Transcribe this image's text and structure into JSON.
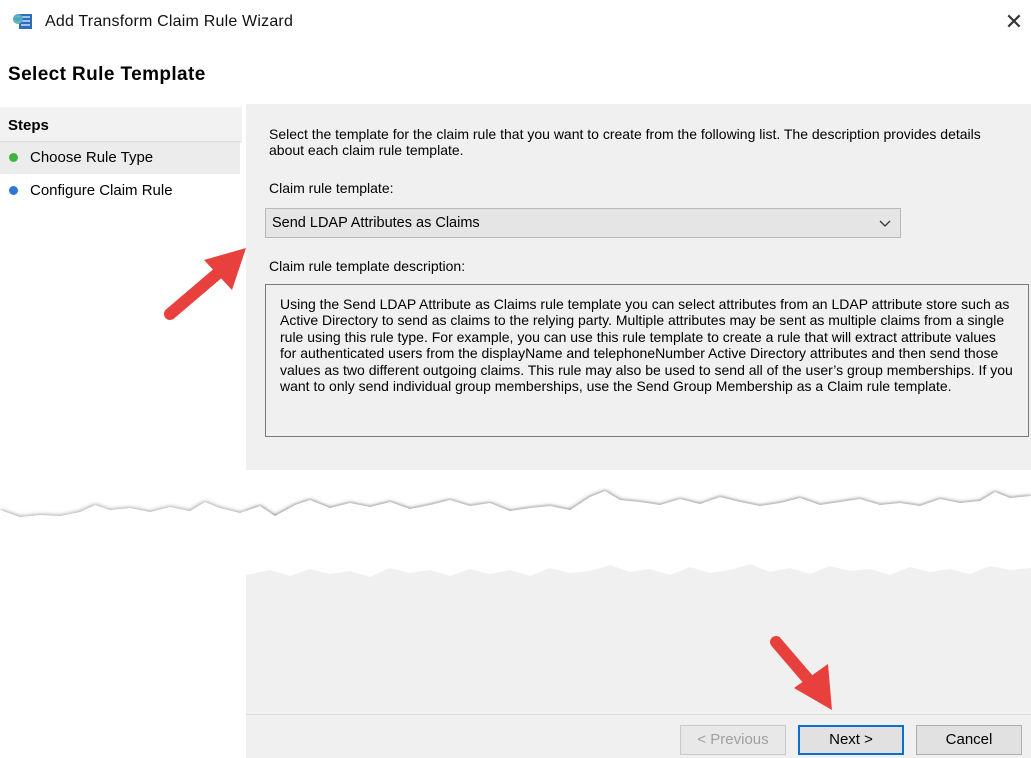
{
  "window": {
    "title": "Add Transform Claim Rule Wizard",
    "close_glyph": "✕"
  },
  "page": {
    "title": "Select Rule Template"
  },
  "steps": {
    "header": "Steps",
    "items": [
      {
        "label": "Choose Rule Type",
        "status": "current",
        "dot_color": "#3fb43f"
      },
      {
        "label": "Configure Claim Rule",
        "status": "pending",
        "dot_color": "#2a78d8"
      }
    ]
  },
  "content": {
    "intro": "Select the template for the claim rule that you want to create from the following list. The description provides details about each claim rule template.",
    "template_label": "Claim rule template:",
    "template_value": "Send LDAP Attributes as Claims",
    "description_label": "Claim rule template description:",
    "description": "Using the Send LDAP Attribute as Claims rule template you can select attributes from an LDAP attribute store such as Active Directory to send as claims to the relying party. Multiple attributes may be sent as multiple claims from a single rule using this rule type. For example, you can use this rule template to create a rule that will extract attribute values for authenticated users from the displayName and telephoneNumber Active Directory attributes and then send those values as two different outgoing claims. This rule may also be used to send all of the user’s group memberships. If you want to only send individual group memberships, use the Send Group Membership as a Claim rule template."
  },
  "footer": {
    "previous_label": "< Previous",
    "next_label": "Next >",
    "cancel_label": "Cancel"
  },
  "annotations": {
    "arrow_color": "#e8403c"
  }
}
